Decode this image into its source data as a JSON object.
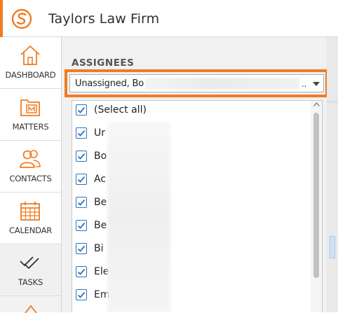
{
  "app": {
    "title": "Taylors Law Firm"
  },
  "colors": {
    "accent": "#f07c22",
    "checkbox": "#2e73b8"
  },
  "sidebar": {
    "items": [
      {
        "label": "DASHBOARD",
        "icon": "home-icon"
      },
      {
        "label": "MATTERS",
        "icon": "folder-icon"
      },
      {
        "label": "CONTACTS",
        "icon": "people-icon"
      },
      {
        "label": "CALENDAR",
        "icon": "calendar-icon"
      },
      {
        "label": "TASKS",
        "icon": "checkmarks-icon"
      }
    ]
  },
  "filter": {
    "section_label": "ASSIGNEES",
    "selected_value": "Unassigned, Bo",
    "ellipsis": "..",
    "options": [
      {
        "label": "(Select all)",
        "checked": true
      },
      {
        "label": "Ur",
        "checked": true
      },
      {
        "label": "Bo",
        "checked": true
      },
      {
        "label": "Ac",
        "checked": true
      },
      {
        "label": "Be",
        "checked": true
      },
      {
        "label": "Be",
        "checked": true
      },
      {
        "label": "Bi",
        "checked": true
      },
      {
        "label": "Ele",
        "checked": true
      },
      {
        "label": "Em",
        "checked": true
      }
    ]
  }
}
